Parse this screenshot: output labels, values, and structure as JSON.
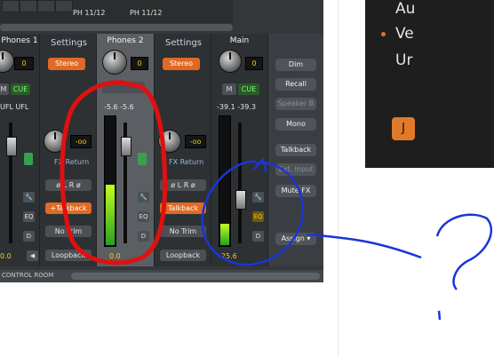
{
  "mixer": {
    "top": {
      "ph_labels": [
        "PH 11/12",
        "PH 11/12"
      ]
    },
    "channels": {
      "phones1": {
        "name": "Phones 1",
        "value": "0",
        "mute": "M",
        "cue": "CUE",
        "levels": "UFL  UFL",
        "bottom": "0.0"
      },
      "settings1": {
        "title": "Settings",
        "stereo": "Stereo",
        "value": "-oo",
        "return_label": "FX Return",
        "phase": "ø L R ø",
        "talkback": "+Talkback",
        "notrim": "No Trim",
        "loopback": "Loopback"
      },
      "phones2": {
        "name": "Phones 2",
        "value": "0",
        "levels": "-5.6  -5.6",
        "eq": "EQ",
        "d": "D",
        "bottom": "0.0"
      },
      "settings2": {
        "title": "Settings",
        "stereo": "Stereo",
        "value": "-oo",
        "return_label": "FX Return",
        "phase": "ø L R ø",
        "talkback": "Talkback",
        "notrim": "No Trim",
        "loopback": "Loopback"
      },
      "main": {
        "name": "Main",
        "value": "0",
        "mute": "M",
        "cue": "CUE",
        "levels": "-39.1  -39.3",
        "eq": "EQ",
        "d": "D",
        "bottom": "-25.6"
      }
    },
    "right": {
      "buttons": [
        "Dim",
        "Recall",
        "Speaker B",
        "Mono",
        "Talkback",
        "Ext. Input",
        "Mute FX"
      ],
      "assign": "Assign"
    },
    "bottom_label": "CONTROL ROOM"
  },
  "dark_panel": {
    "line1": "Au",
    "line2": "Ve",
    "line3": "Ur",
    "button": "J"
  },
  "annotations": {
    "circle1_color": "#e01010",
    "circle2_color": "#1a35d8",
    "note": "?"
  }
}
